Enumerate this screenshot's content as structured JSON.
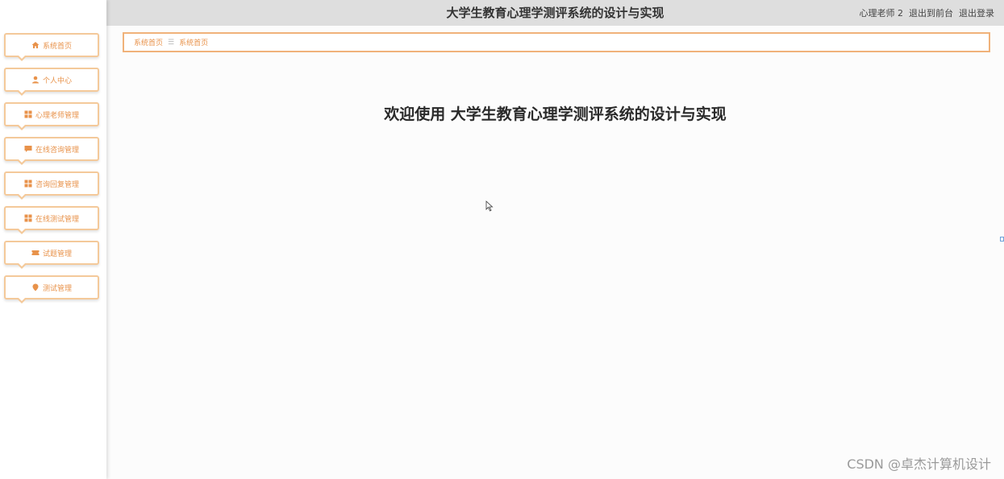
{
  "header": {
    "title": "大学生教育心理学测评系统的设计与实现",
    "user": "心理老师 2",
    "to_front": "退出到前台",
    "logout": "退出登录"
  },
  "sidebar": {
    "items": [
      {
        "label": "系统首页",
        "icon": "home-icon"
      },
      {
        "label": "个人中心",
        "icon": "user-icon"
      },
      {
        "label": "心理老师管理",
        "icon": "grid-icon"
      },
      {
        "label": "在线咨询管理",
        "icon": "chat-icon"
      },
      {
        "label": "咨询回复管理",
        "icon": "grid-icon"
      },
      {
        "label": "在线测试管理",
        "icon": "grid-icon"
      },
      {
        "label": "试题管理",
        "icon": "ticket-icon"
      },
      {
        "label": "测试管理",
        "icon": "location-icon"
      }
    ]
  },
  "breadcrumb": {
    "root": "系统首页",
    "separator": "☰",
    "current": "系统首页"
  },
  "main": {
    "welcome": "欢迎使用 大学生教育心理学测评系统的设计与实现"
  },
  "watermark": "CSDN @卓杰计算机设计",
  "colors": {
    "accent": "#e8924a",
    "border": "#f0b27a",
    "header_bg": "#dedede"
  }
}
